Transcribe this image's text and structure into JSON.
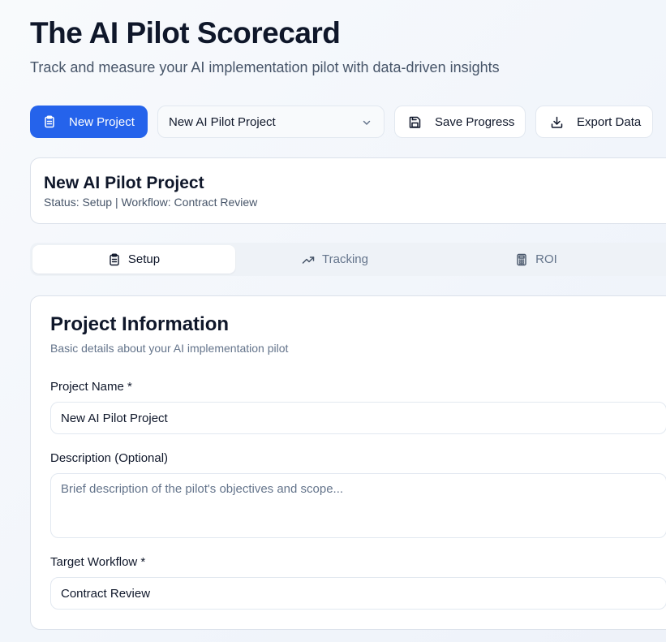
{
  "header": {
    "title": "The AI Pilot Scorecard",
    "subtitle": "Track and measure your AI implementation pilot with data-driven insights"
  },
  "toolbar": {
    "new_project_label": "New Project",
    "project_select_value": "New AI Pilot Project",
    "save_label": "Save Progress",
    "export_label": "Export Data"
  },
  "project_card": {
    "title": "New AI Pilot Project",
    "status_line": "Status: Setup | Workflow: Contract Review"
  },
  "tabs": [
    {
      "label": "Setup",
      "icon": "clipboard-icon",
      "active": true
    },
    {
      "label": "Tracking",
      "icon": "trending-up-icon",
      "active": false
    },
    {
      "label": "ROI",
      "icon": "calculator-icon",
      "active": false
    }
  ],
  "form": {
    "section_title": "Project Information",
    "section_description": "Basic details about your AI implementation pilot",
    "project_name_label": "Project Name *",
    "project_name_value": "New AI Pilot Project",
    "description_label": "Description (Optional)",
    "description_placeholder": "Brief description of the pilot's objectives and scope...",
    "workflow_label": "Target Workflow *",
    "workflow_value": "Contract Review"
  },
  "colors": {
    "primary": "#2563eb",
    "text": "#0f172a",
    "muted": "#475569",
    "border": "#e2e8f0"
  }
}
